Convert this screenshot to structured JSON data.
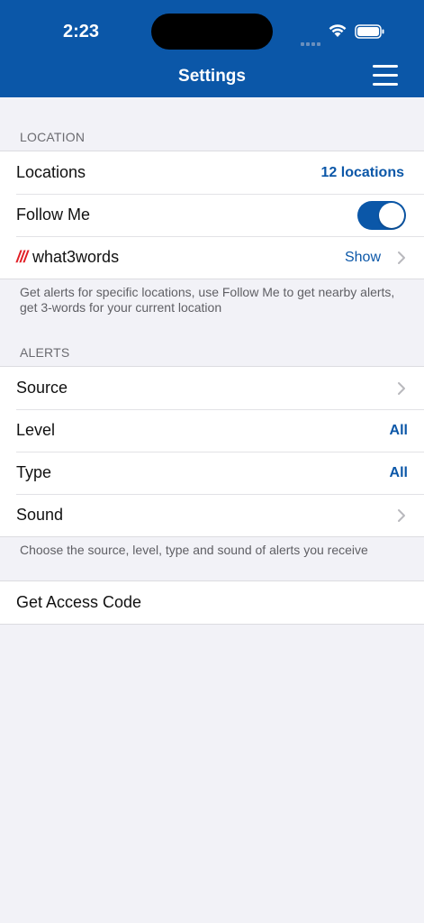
{
  "status": {
    "time": "2:23"
  },
  "header": {
    "title": "Settings"
  },
  "location_section": {
    "header": "LOCATION",
    "rows": {
      "locations": {
        "label": "Locations",
        "value": "12 locations"
      },
      "follow_me": {
        "label": "Follow Me",
        "enabled": true
      },
      "what3words": {
        "mark": "///",
        "label": "what3words",
        "value": "Show"
      }
    },
    "footnote": "Get alerts for specific locations, use Follow Me to get nearby alerts, get 3-words for your current location"
  },
  "alerts_section": {
    "header": "ALERTS",
    "rows": {
      "source": {
        "label": "Source"
      },
      "level": {
        "label": "Level",
        "value": "All"
      },
      "type": {
        "label": "Type",
        "value": "All"
      },
      "sound": {
        "label": "Sound"
      }
    },
    "footnote": "Choose the source, level, type and sound of alerts you receive"
  },
  "access": {
    "label": "Get Access Code"
  },
  "colors": {
    "accent": "#0b57a8",
    "w3w_red": "#e11f26",
    "background": "#f2f2f7"
  }
}
